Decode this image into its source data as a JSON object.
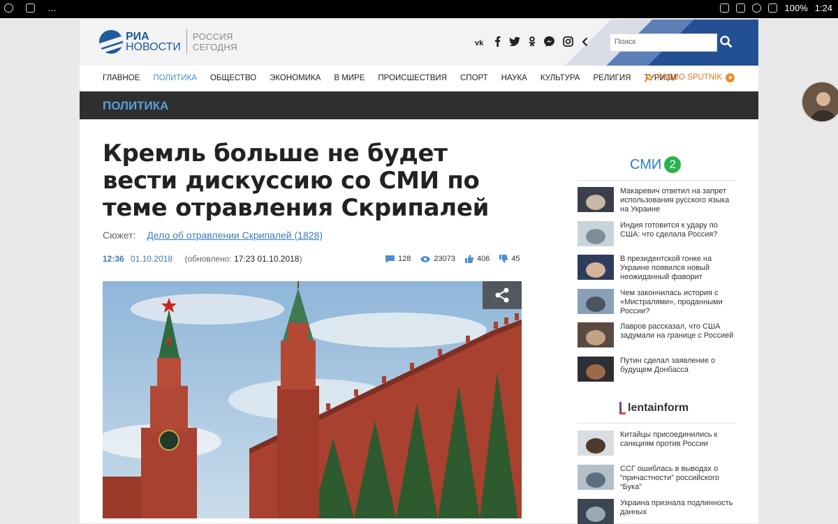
{
  "status_bar": {
    "time": "1:24",
    "battery": "100%"
  },
  "header": {
    "logo_ria_line1": "РИА",
    "logo_ria_line2": "НОВОСТИ",
    "logo_rs_line1": "РОССИЯ",
    "logo_rs_line2": "СЕГОДНЯ",
    "social_icons": [
      "vk-icon",
      "facebook-icon",
      "twitter-icon",
      "odnoklassniki-icon",
      "messenger-icon",
      "instagram-icon",
      "chevron-left-icon"
    ],
    "search_placeholder": "Поиск"
  },
  "nav": {
    "items": [
      "ГЛАВНОЕ",
      "ПОЛИТИКА",
      "ОБЩЕСТВО",
      "ЭКОНОМИКА",
      "В МИРЕ",
      "ПРОИСШЕСТВИЯ",
      "СПОРТ",
      "НАУКА",
      "КУЛЬТУРА",
      "РЕЛИГИЯ",
      "ТУРИЗМ"
    ],
    "active": "ПОЛИТИКА",
    "radio_label": "РАДИО SPUTNIK"
  },
  "section": {
    "title": "ПОЛИТИКА"
  },
  "article": {
    "title": "Кремль больше не будет вести дискуссию со СМИ по теме отравления Скрипалей",
    "story_label": "Сюжет:",
    "story_link": "Дело об отравлении Скрипалей (1828)",
    "time": "12:36",
    "date": "01.10.2018",
    "updated_prefix": "(обновлено:",
    "updated_value": "17:23 01.10.2018",
    "updated_suffix": ")",
    "stats": {
      "comments": "128",
      "views": "23073",
      "likes": "406",
      "dislikes": "45"
    }
  },
  "sidebar": {
    "smi2_label": "СМИ",
    "smi2_num": "2",
    "smi2_news": [
      "Макаревич ответил на запрет использования русского языка на Украине",
      "Индия готовится к удару по США: что сделала Россия?",
      "В президентской гонке на Украине появился новый неожиданный фаворит",
      "Чем закончилась история с «Мистралями», проданными России?",
      "Лавров рассказал, что США задумали на границе с Россией",
      "Путин сделал заявление о будущем Донбасса"
    ],
    "lenta_label": "lentainform",
    "lenta_news": [
      "Китайцы присоединились к санкциям против России",
      "ССГ ошиблась в выводах о “причастности” российского “Бука”",
      "Украина признала подлинность данных"
    ]
  },
  "colors": {
    "accent": "#4a90c8",
    "section_bar": "#2f2f2f",
    "radio": "#e87722",
    "smi2_green": "#2ab34a"
  }
}
